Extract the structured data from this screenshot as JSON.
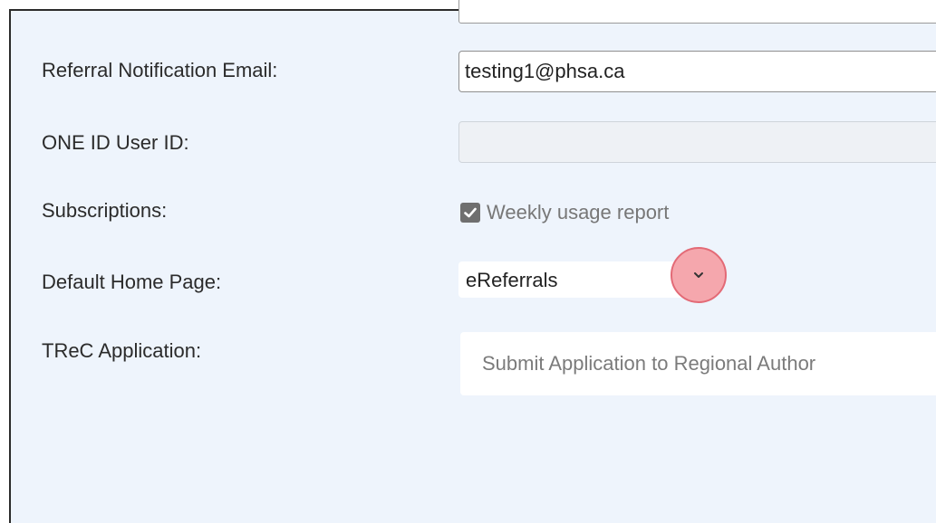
{
  "form": {
    "referral_email": {
      "label": "Referral Notification Email:",
      "value": "testing1@phsa.ca"
    },
    "one_id": {
      "label": "ONE ID User ID:",
      "value": ""
    },
    "subscriptions": {
      "label": "Subscriptions:",
      "option_label": "Weekly usage report",
      "checked": true
    },
    "default_home_page": {
      "label": "Default Home Page:",
      "selected": "eReferrals"
    },
    "trec_application": {
      "label": "TReC Application:",
      "button_label": "Submit Application to Regional Author"
    }
  },
  "icons": {
    "checkbox": "check-icon",
    "dropdown": "chevron-down-icon"
  },
  "colors": {
    "panel_background": "#eef4fc",
    "dropdown_highlight": "#f5a7ad",
    "dropdown_highlight_border": "#e36a76"
  }
}
